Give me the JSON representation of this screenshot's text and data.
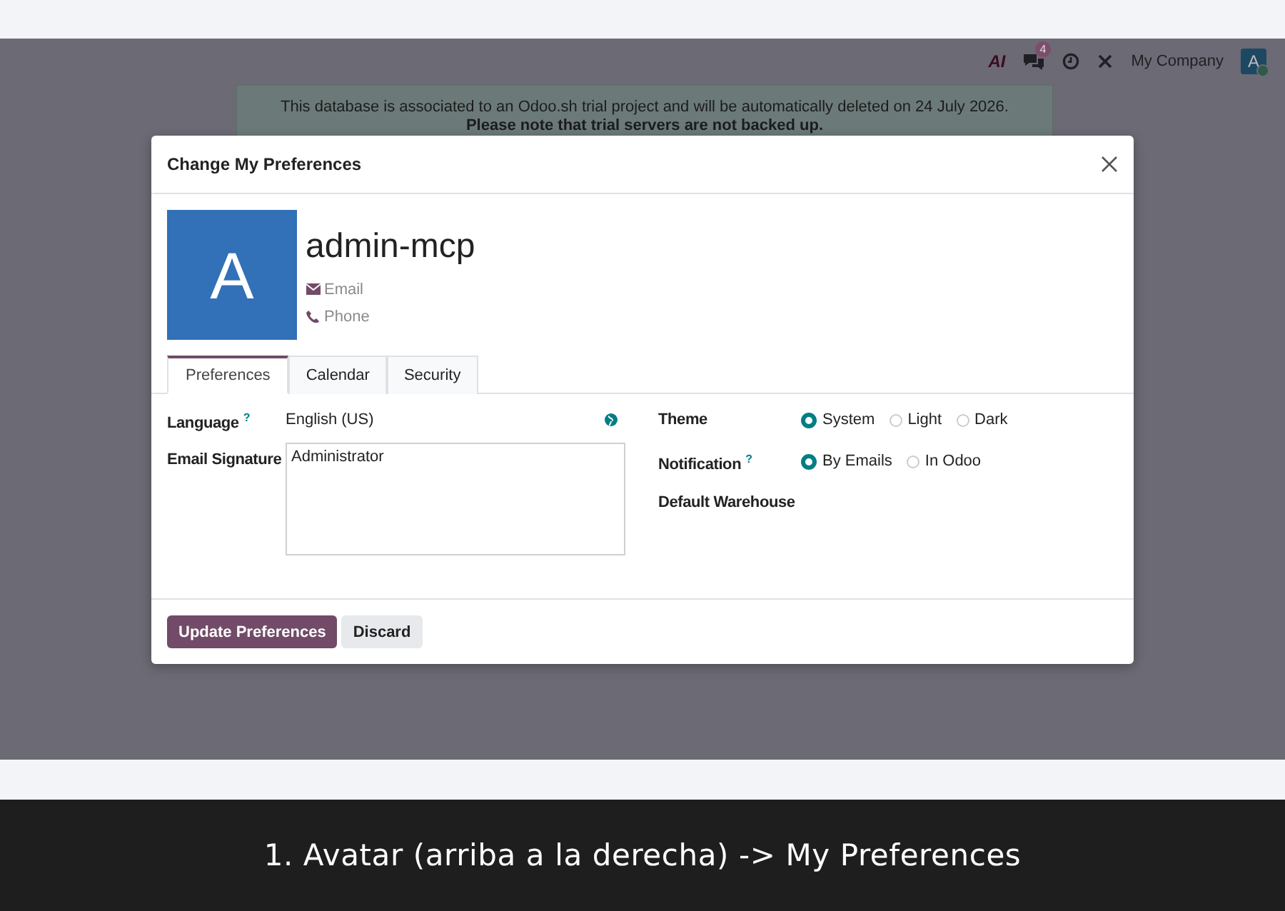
{
  "navbar": {
    "ai_label": "AI",
    "chat_badge": "4",
    "company": "My Company",
    "avatar_letter": "A"
  },
  "banner": {
    "lines": [
      "This database is associated to an Odoo.sh trial project and will be automatically deleted on 24 July 2026.",
      "Please note that trial servers are not backed up."
    ]
  },
  "dialog": {
    "title": "Change My Preferences",
    "avatar_letter": "A",
    "name": "admin-mcp",
    "contact": [
      {
        "kind": "email",
        "placeholder": "Email"
      },
      {
        "kind": "phone",
        "placeholder": "Phone"
      }
    ],
    "tabs": [
      {
        "label": "Preferences",
        "selected": true
      },
      {
        "label": "Calendar",
        "selected": false
      },
      {
        "label": "Security",
        "selected": false
      }
    ],
    "fields_left": [
      {
        "label": "Language",
        "help": "?",
        "kind": "select",
        "value": "English (US)"
      },
      {
        "label": "Email Signature",
        "kind": "textarea",
        "value": "Administrator"
      }
    ],
    "fields_right": [
      {
        "label": "Theme",
        "kind": "radio",
        "options": [
          {
            "label": "System",
            "selected": true
          },
          {
            "label": "Light",
            "selected": false
          },
          {
            "label": "Dark",
            "selected": false
          }
        ]
      },
      {
        "label": "Notification",
        "help": "?",
        "kind": "radio",
        "options": [
          {
            "label": "By Emails",
            "selected": true
          },
          {
            "label": "In Odoo",
            "selected": false
          }
        ]
      },
      {
        "label": "Default Warehouse",
        "kind": "empty"
      }
    ],
    "buttons": [
      {
        "label": "Update Preferences",
        "kind": "primary"
      },
      {
        "label": "Discard",
        "kind": "secondary"
      }
    ]
  },
  "caption": "1. Avatar (arriba a la derecha) -> My Preferences"
}
